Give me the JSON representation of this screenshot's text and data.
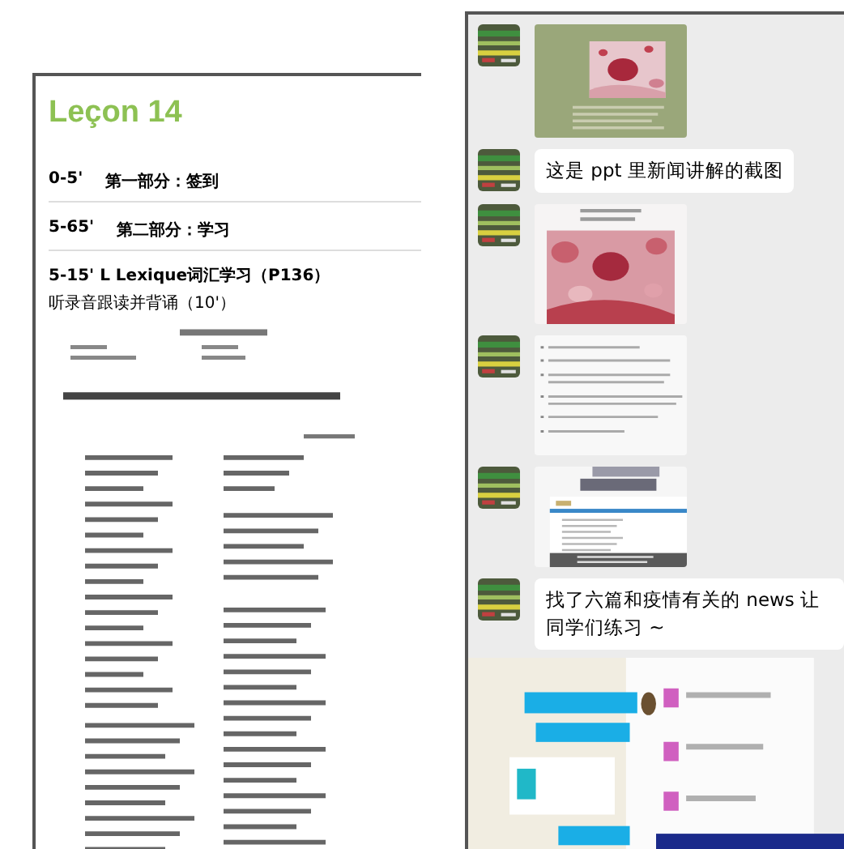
{
  "document": {
    "title": "Leçon 14",
    "sections": [
      {
        "time": "0-5'",
        "heading": "第一部分：签到"
      },
      {
        "time": "5-65'",
        "heading": "第二部分：学习"
      }
    ],
    "activity": "5-15' L Lexique词汇学习（P136）",
    "instruction": "听录音跟读并背诵（10'）"
  },
  "chat": {
    "messages": [
      {
        "kind": "picture"
      },
      {
        "kind": "text",
        "text": "这是 ppt 里新闻讲解的截图"
      },
      {
        "kind": "picture"
      },
      {
        "kind": "picture"
      },
      {
        "kind": "picture"
      },
      {
        "kind": "text",
        "text": "找了六篇和疫情有关的 news 让同学们练习 ~"
      }
    ]
  }
}
